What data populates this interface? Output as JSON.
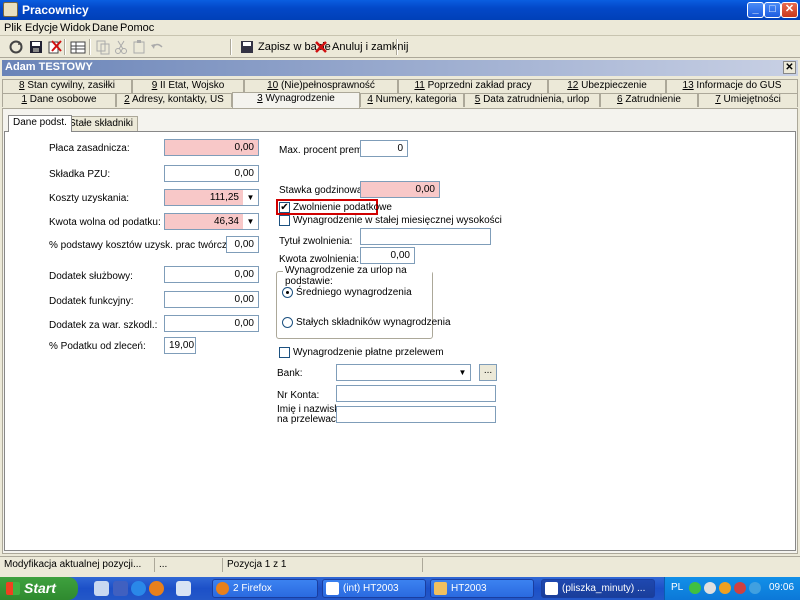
{
  "window": {
    "title": "Pracownicy"
  },
  "menu": [
    "Plik",
    "Edycje",
    "Widok",
    "Dane",
    "Pomoc"
  ],
  "toolbar": {
    "save_label": "Zapisz w bazie",
    "cancel_label": "Anuluj i zamknij"
  },
  "user": {
    "name": "Adam TESTOWY"
  },
  "tabs_row1": [
    {
      "num": "8",
      "label": " Stan cywilny, zasiłki"
    },
    {
      "num": "9",
      "label": " II Etat, Wojsko"
    },
    {
      "num": "10",
      "label": " (Nie)pełnosprawność"
    },
    {
      "num": "11",
      "label": " Poprzedni zakład pracy"
    },
    {
      "num": "12",
      "label": " Ubezpieczenie"
    },
    {
      "num": "13",
      "label": " Informacje do GUS"
    }
  ],
  "tabs_row2": [
    {
      "num": "1",
      "label": " Dane osobowe"
    },
    {
      "num": "2",
      "label": " Adresy, kontakty, US"
    },
    {
      "num": "3",
      "label": " Wynagrodzenie"
    },
    {
      "num": "4",
      "label": " Numery, kategoria"
    },
    {
      "num": "5",
      "label": " Data zatrudnienia, urlop"
    },
    {
      "num": "6",
      "label": " Zatrudnienie"
    },
    {
      "num": "7",
      "label": " Umiejętności"
    }
  ],
  "subtabs": [
    "Dane podst.",
    "Stałe składniki"
  ],
  "left_fields": [
    {
      "label": "Płaca zasadnicza:",
      "value": "0,00"
    },
    {
      "label": "Składka PZU:",
      "value": "0,00"
    },
    {
      "label": "Koszty uzyskania:",
      "value": "111,25"
    },
    {
      "label": "Kwota wolna od podatku:",
      "value": "46,34"
    },
    {
      "label": "% podstawy kosztów uzysk. prac twórczych:",
      "value": "0,00"
    },
    {
      "label": "Dodatek służbowy:",
      "value": "0,00"
    },
    {
      "label": "Dodatek funkcyjny:",
      "value": "0,00"
    },
    {
      "label": "Dodatek za war. szkodl.:",
      "value": "0,00"
    },
    {
      "label": "% Podatku od zleceń:",
      "value": "19,00"
    }
  ],
  "right": {
    "max_premia_label": "Max. procent premii:",
    "max_premia_value": "0",
    "stawka_label": "Stawka godzinowa:",
    "stawka_value": "0,00",
    "zwolnienie_label": "Zwolnienie podatkowe",
    "zwolnienie_checked": "✔",
    "stala_label": "Wynagrodzenie w stałej miesięcznej wysokości",
    "tytul_label": "Tytuł zwolnienia:",
    "tytul_value": "",
    "kwota_label": "Kwota zwolnienia:",
    "kwota_value": "0,00",
    "urlop_group_title": "Wynagrodzenie za urlop na podstawie:",
    "radio1_label": "Średniego wynagrodzenia",
    "radio2_label": "Stałych składników wynagrodzenia",
    "przelew_label": "Wynagrodzenie płatne przelewem",
    "bank_label": "Bank:",
    "bank_value": "",
    "konto_label": "Nr Konta:",
    "konto_value": "",
    "imie_label_1": "Imię i nazwisko",
    "imie_label_2": "na przelewach:",
    "imie_value": "",
    "ellipsis": "..."
  },
  "status": {
    "message": "Modyfikacja aktualnej pozycji...",
    "dots": "...",
    "position": "Pozycja 1 z 1"
  },
  "taskbar": {
    "start": "Start",
    "tasks": [
      "2 Firefox",
      "(int) HT2003",
      "HT2003",
      "(pliszka_minuty) ..."
    ],
    "lang": "PL",
    "clock": "09:06"
  }
}
